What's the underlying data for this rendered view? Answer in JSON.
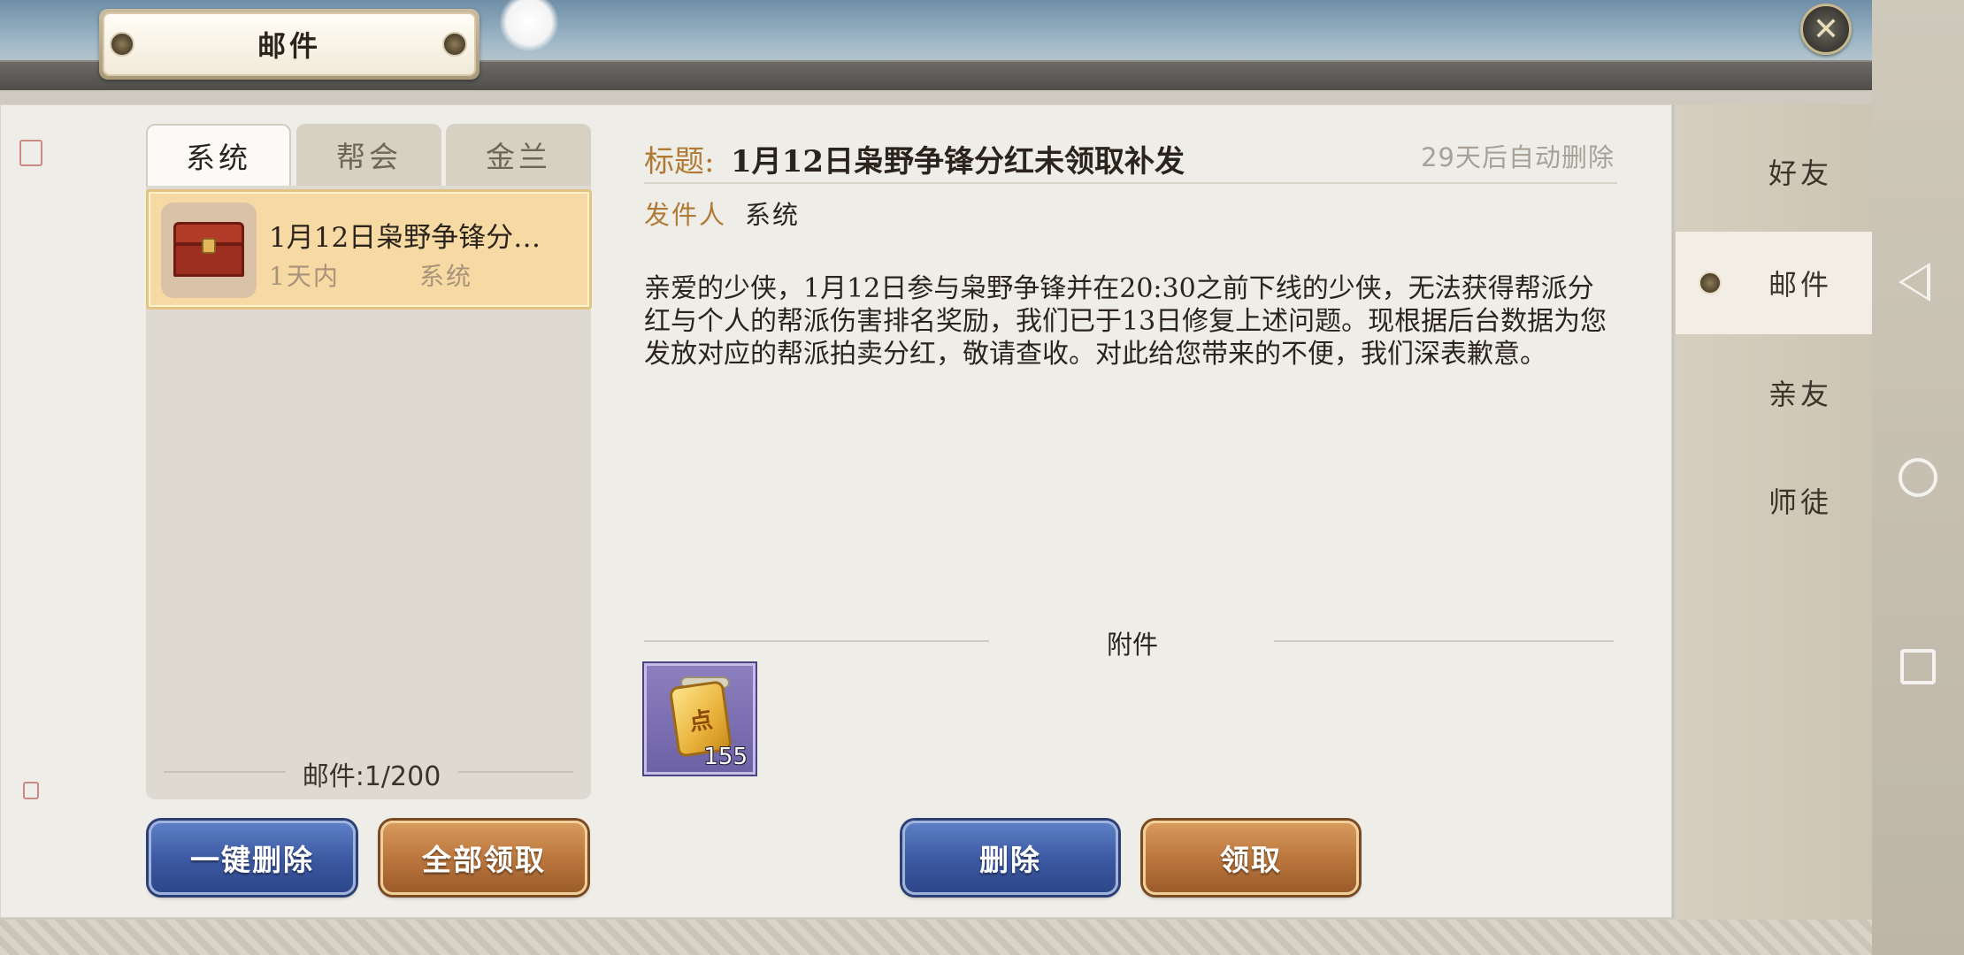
{
  "window": {
    "title": "邮件"
  },
  "tabs": [
    {
      "label": "系统",
      "active": true
    },
    {
      "label": "帮会",
      "active": false
    },
    {
      "label": "金兰",
      "active": false
    }
  ],
  "mail_list": {
    "items": [
      {
        "title": "1月12日枭野争锋分…",
        "time": "1天内",
        "sender": "系统",
        "selected": true
      }
    ],
    "count_label": "邮件:1/200"
  },
  "list_buttons": {
    "delete_all": "一键删除",
    "claim_all": "全部领取"
  },
  "detail": {
    "title_label": "标题:",
    "title": "1月12日枭野争锋分红未领取补发",
    "auto_delete": "29天后自动删除",
    "sender_label": "发件人",
    "sender": "系统",
    "body": "亲爱的少侠，1月12日参与枭野争锋并在20:30之前下线的少侠，无法获得帮派分红与个人的帮派伤害排名奖励，我们已于13日修复上述问题。现根据后台数据为您发放对应的帮派拍卖分红，敬请查收。对此给您带来的不便，我们深表歉意。",
    "attachment_label": "附件",
    "attachment": {
      "icon": "gold-scroll-icon",
      "glyph": "点",
      "quantity": "155"
    },
    "delete_button": "删除",
    "claim_button": "领取"
  },
  "sidebar": {
    "items": [
      {
        "label": "好友",
        "active": false
      },
      {
        "label": "邮件",
        "active": true
      },
      {
        "label": "亲友",
        "active": false
      },
      {
        "label": "师徒",
        "active": false
      }
    ]
  },
  "colors": {
    "accent_gold": "#b07a35",
    "selected_mail_bg": "#f6d9a3",
    "blue_button": "#3a57a0",
    "orange_button": "#b8743b",
    "attachment_purple": "#7a6db0"
  }
}
